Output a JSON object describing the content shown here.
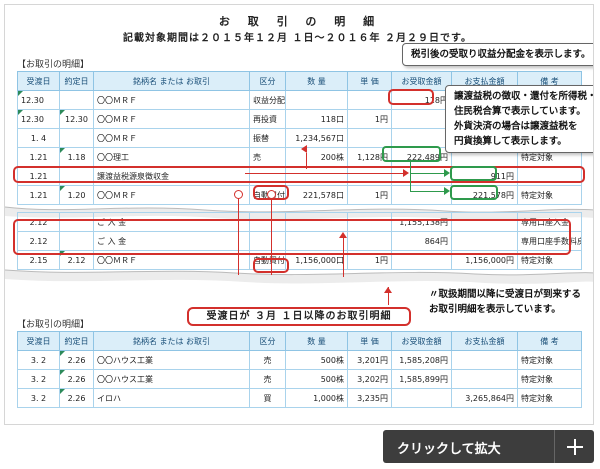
{
  "document": {
    "title": "お 取 引 の 明 細",
    "period": "記載対象期間は２０１５年１２月 １日～２０１６年 ２月２９日です。"
  },
  "table1": {
    "section_label": "【お取引の明細】",
    "headers": [
      "受渡日",
      "約定日",
      "銘柄名 または お取引",
      "区分",
      "数 量",
      "単 価",
      "お受取金額",
      "お支払金額",
      "備 考"
    ],
    "rows": [
      [
        "12.30",
        "",
        "〇〇ＭＲＦ",
        "収益分配",
        "",
        "",
        "118円",
        "",
        ""
      ],
      [
        "12.30",
        "12.30",
        "〇〇ＭＲＦ",
        "再投資",
        "118口",
        "1円",
        "",
        "",
        ""
      ],
      [
        "1. 4",
        "",
        "〇〇ＭＲＦ",
        "振替",
        "1,234,567口",
        "",
        "",
        "",
        ""
      ],
      [
        "1.21",
        "1.18",
        "〇〇理工",
        "売",
        "200株",
        "1,128円",
        "222,489円",
        "",
        "特定対象"
      ],
      [
        "1.21",
        "",
        "譲渡益税源泉徴収金",
        "",
        "",
        "",
        "",
        "911円",
        ""
      ],
      [
        "1.21",
        "1.20",
        "〇〇ＭＲＦ",
        "自動買付",
        "221,578口",
        "1円",
        "",
        "221,578円",
        "特定対象"
      ]
    ]
  },
  "table1b": {
    "rows": [
      [
        "2.12",
        "",
        "ご 入 金",
        "",
        "",
        "",
        "1,155,138円",
        "",
        "専用口座入金"
      ],
      [
        "2.12",
        "",
        "ご 入 金",
        "",
        "",
        "",
        "864円",
        "",
        "専用口座手数料戻し"
      ],
      [
        "2.15",
        "2.12",
        "〇〇ＭＲＦ",
        "自動買付",
        "1,156,000口",
        "1円",
        "",
        "1,156,000円",
        "特定対象"
      ]
    ]
  },
  "table2": {
    "section_label": "【お取引の明細】",
    "headers": [
      "受渡日",
      "約定日",
      "銘柄名 または お取引",
      "区分",
      "数 量",
      "単 価",
      "お受取金額",
      "お支払金額",
      "備 考"
    ],
    "rows": [
      [
        "3. 2",
        "2.26",
        "〇〇ハウス工業",
        "売",
        "500株",
        "3,201円",
        "1,585,208円",
        "",
        "特定対象"
      ],
      [
        "3. 2",
        "2.26",
        "〇〇ハウス工業",
        "売",
        "500株",
        "3,202円",
        "1,585,899円",
        "",
        "特定対象"
      ],
      [
        "3. 2",
        "2.26",
        "イロハ",
        "買",
        "1,000株",
        "3,235円",
        "",
        "3,265,864円",
        "特定対象"
      ]
    ]
  },
  "notes": {
    "top": "税引後の受取り収益分配金を表示します。",
    "mid_lines": [
      "譲渡益税の徴収・還付を所得税・",
      "住民税合算で表示しています。",
      "外貨決済の場合は譲渡益税を",
      "円貨換算して表示します。"
    ],
    "bottom_lines": [
      "〃取扱期間以降に受渡日が到来する",
      "お取引明細を表示しています。"
    ],
    "banner": "受渡日が ３月 １日以降のお取引明細"
  },
  "zoom_button": {
    "label": "クリックして拡大",
    "icon": "plus-icon"
  },
  "colors": {
    "header_bg": "#dbeef9",
    "accent_red": "#d3302c",
    "accent_green": "#2e9a4c",
    "zoom_bg": "#3d3d3d"
  }
}
